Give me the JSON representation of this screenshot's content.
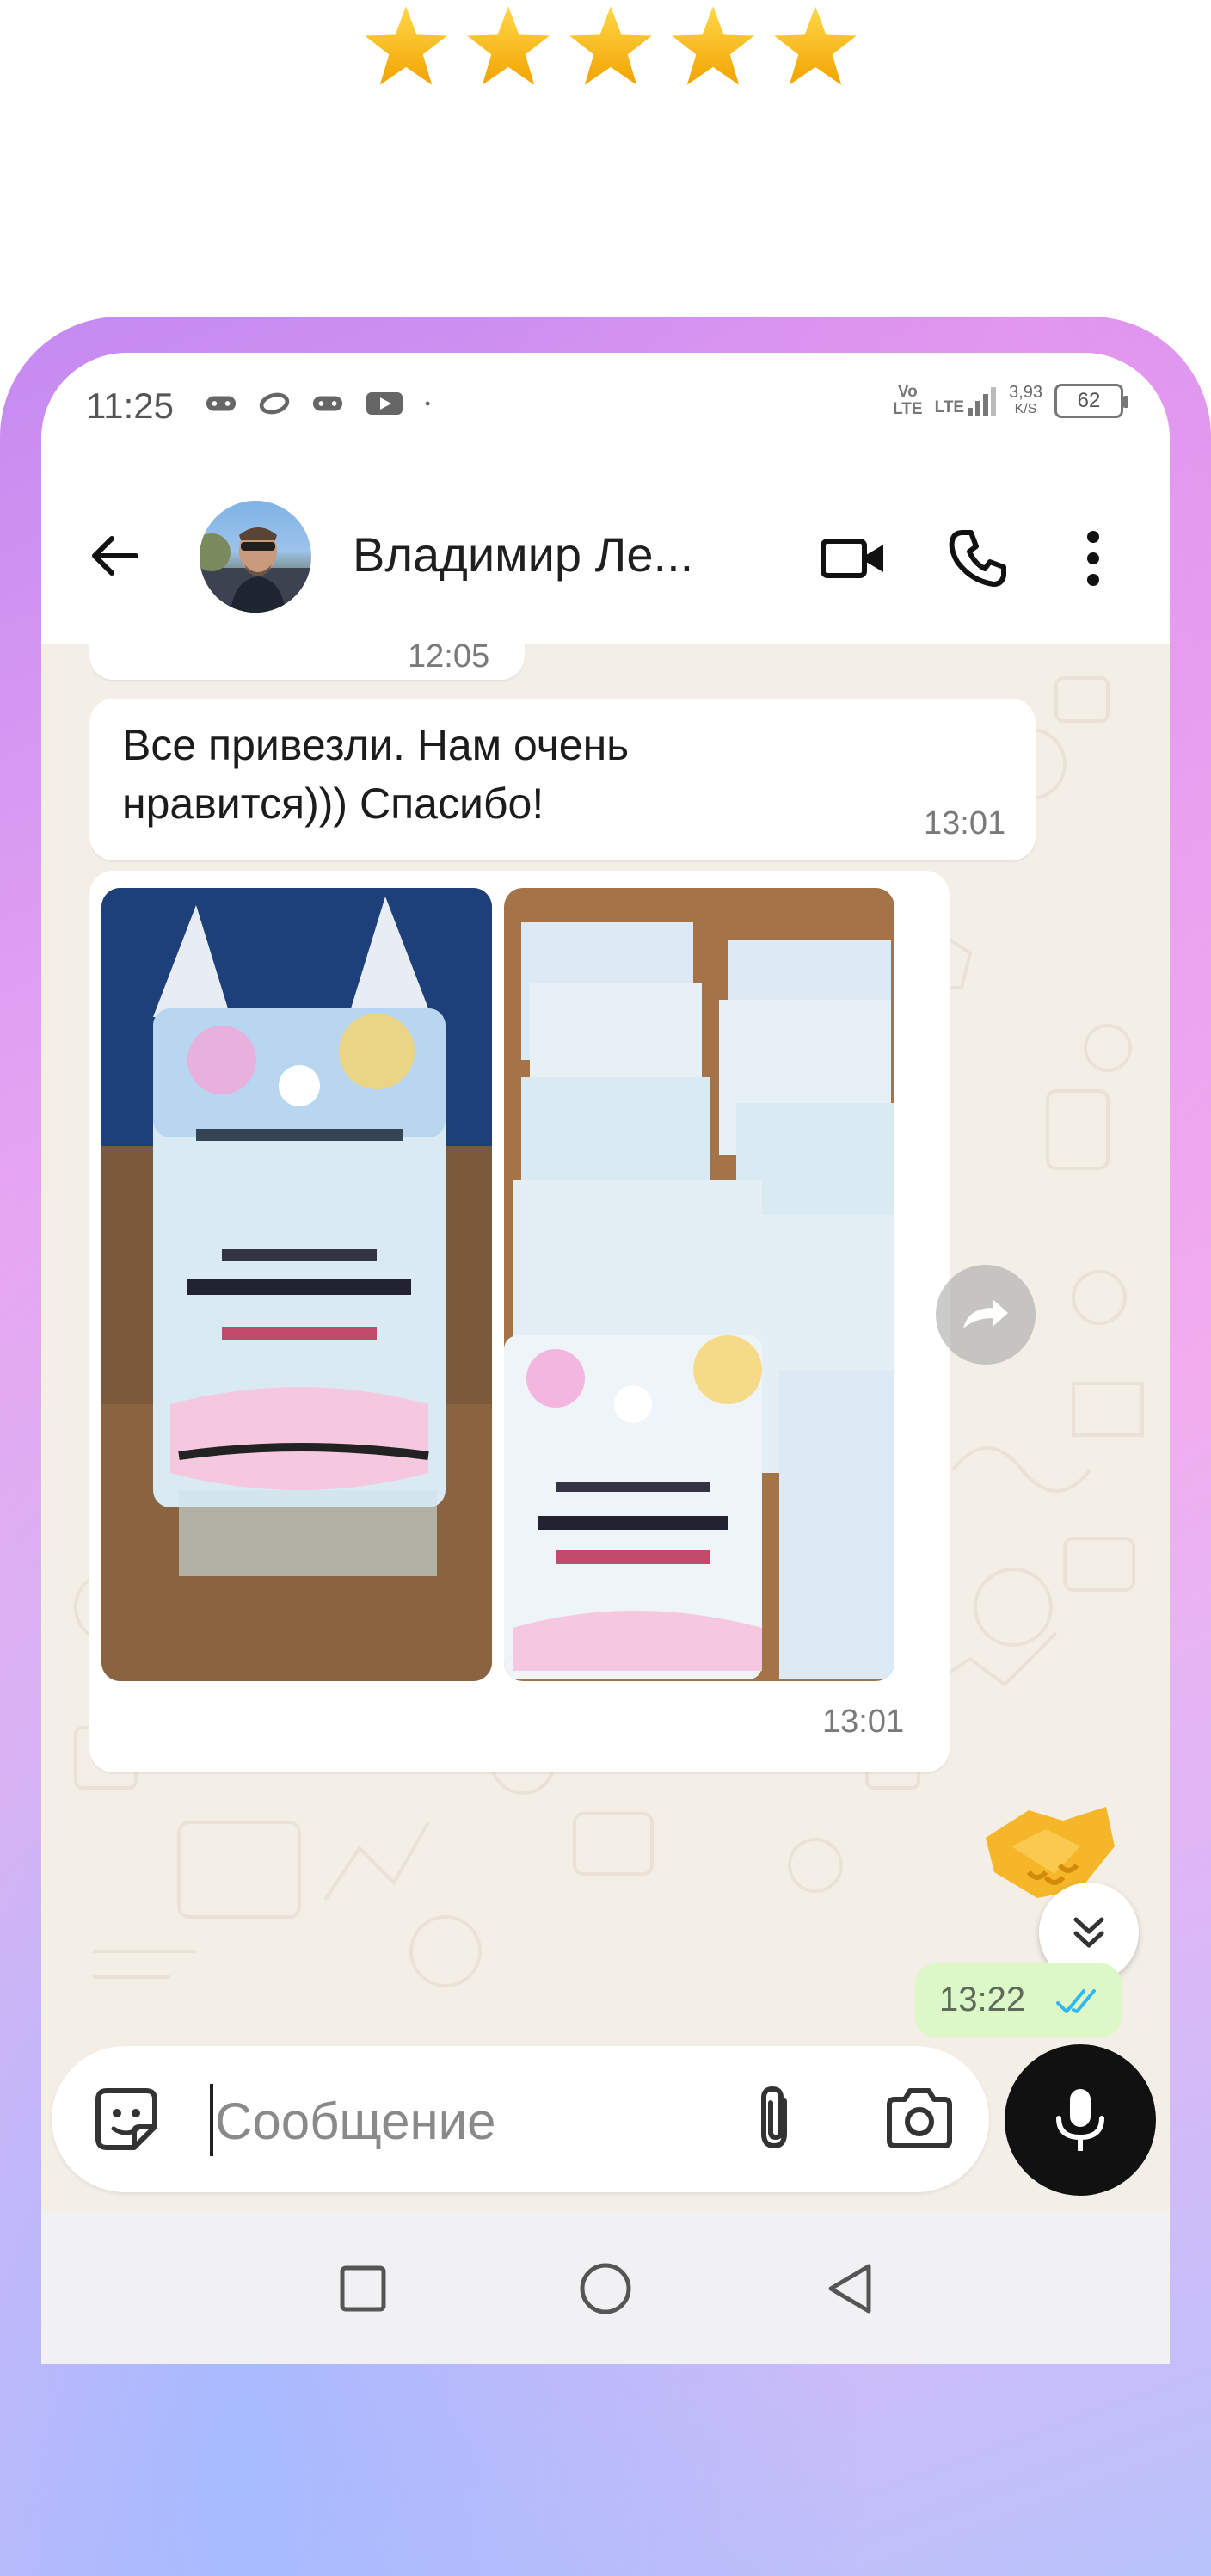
{
  "rating": {
    "stars": 5,
    "star_color": "#f5b800"
  },
  "status_bar": {
    "time": "11:25",
    "left_icons": [
      "gamepad-icon",
      "ring-icon",
      "gamepad-icon",
      "youtube-icon",
      "dot-icon"
    ],
    "network_label_top": "Vo",
    "network_label_bottom": "LTE",
    "lte_label": "LTE",
    "speed_value": "3,93",
    "speed_unit": "K/S",
    "battery": "62"
  },
  "header": {
    "contact_name": "Владимир Ле...",
    "actions": [
      "video-call-icon",
      "phone-icon",
      "more-icon"
    ]
  },
  "messages": {
    "partial_prev_time": "12:05",
    "text_message": {
      "line1": "Все привезли. Нам очень",
      "line2": "нравится))) Спасибо!",
      "time": "13:01"
    },
    "photo_message": {
      "time": "13:01"
    },
    "outgoing": {
      "emoji": "handshake",
      "time": "13:22",
      "status": "read"
    }
  },
  "composer": {
    "placeholder": "Сообщение"
  },
  "colors": {
    "outgoing_bubble": "#dcf8c6",
    "read_ticks": "#34b7f1",
    "chat_background": "#f4efe6"
  }
}
